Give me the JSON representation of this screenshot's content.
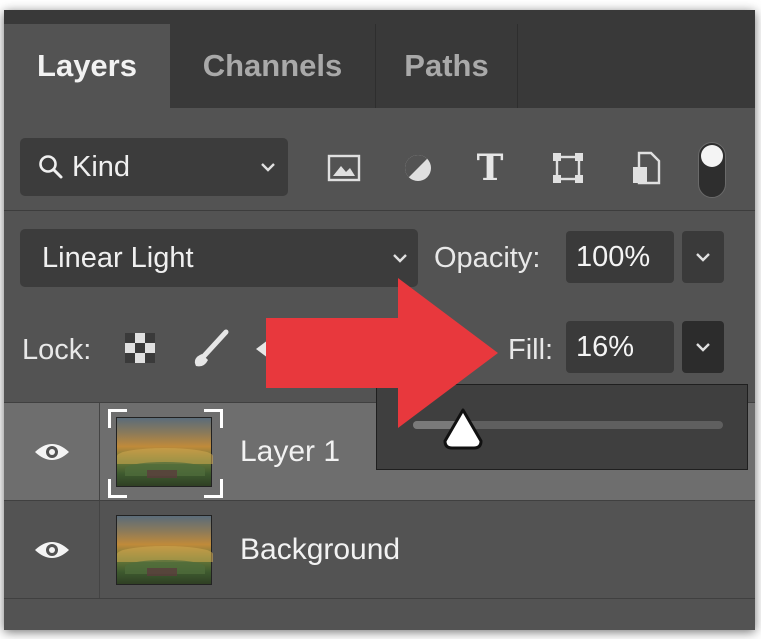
{
  "tabs": [
    {
      "label": "Layers",
      "active": true
    },
    {
      "label": "Channels",
      "active": false
    },
    {
      "label": "Paths",
      "active": false
    }
  ],
  "filter": {
    "kind_label": "Kind",
    "filter_icons": [
      "image-filter-icon",
      "adjustment-filter-icon",
      "type-filter-icon",
      "shape-filter-icon",
      "smart-object-filter-icon"
    ],
    "type_glyph": "T",
    "filter_toggle_on": true
  },
  "blend": {
    "mode": "Linear Light",
    "opacity_label": "Opacity:",
    "opacity_value": "100%"
  },
  "lock": {
    "label": "Lock:",
    "fill_label": "Fill:",
    "fill_value": "16%"
  },
  "fill_slider": {
    "value": 0.16
  },
  "layers": [
    {
      "name": "Layer 1",
      "selected": true,
      "visible": true
    },
    {
      "name": "Background",
      "selected": false,
      "visible": true
    }
  ],
  "colors": {
    "panel": "#535353",
    "tabbar": "#393939",
    "selected_row": "#6e6e6e",
    "arrow": "#e8383d"
  }
}
